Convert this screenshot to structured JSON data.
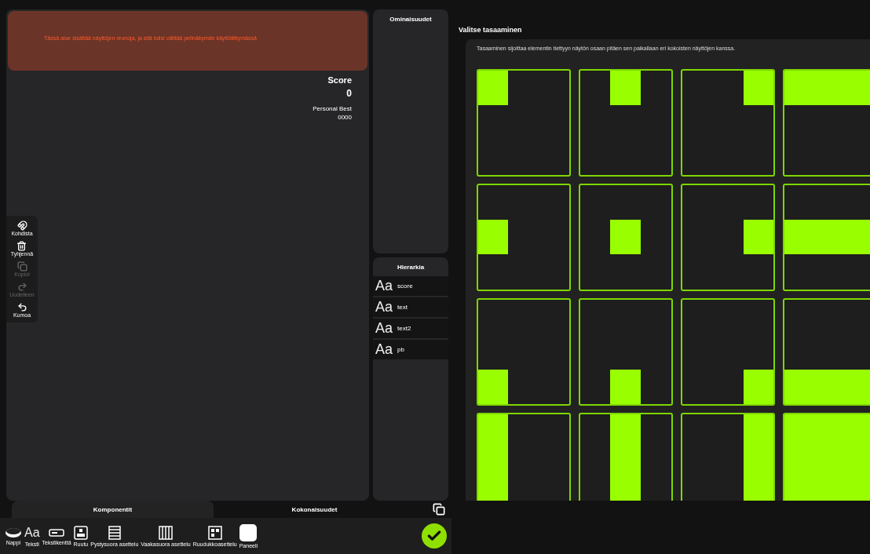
{
  "banner": {
    "text": "Tässä alue sisältää näyttöjen reunoja, ja sitä tulisi välttää pelinäkymän käyttöliittymässä"
  },
  "score": {
    "label": "Score",
    "value": "0",
    "best_label": "Personal Best",
    "best_value": "0000"
  },
  "tools": [
    {
      "label": "Kohdista",
      "disabled": false
    },
    {
      "label": "Tyhjennä",
      "disabled": false
    },
    {
      "label": "Kopioi",
      "disabled": true
    },
    {
      "label": "Uudelleen",
      "disabled": true
    },
    {
      "label": "Kumoa",
      "disabled": false
    }
  ],
  "properties": {
    "title": "Ominaisuudet"
  },
  "hierarchy": {
    "title": "Hierarkia",
    "items": [
      {
        "icon": "Aa",
        "label": "score"
      },
      {
        "icon": "Aa",
        "label": "text"
      },
      {
        "icon": "Aa",
        "label": "text2"
      },
      {
        "icon": "Aa",
        "label": "pb"
      }
    ]
  },
  "bottom_tabs": [
    {
      "label": "Komponentit",
      "selected": true
    },
    {
      "label": "Kokonaisuudet",
      "selected": false
    }
  ],
  "components": [
    {
      "kind": "button",
      "label": "Nappi"
    },
    {
      "kind": "text",
      "label": "Teksti",
      "glyph": "Aa"
    },
    {
      "kind": "field",
      "label": "Tekstikenttä"
    },
    {
      "kind": "box",
      "label": "Ruutu"
    },
    {
      "kind": "rows",
      "label": "Pystysuora asettelu"
    },
    {
      "kind": "columns",
      "label": "Vaakasuora asettelu"
    },
    {
      "kind": "grid",
      "label": "Ruudukkoasettelu"
    },
    {
      "kind": "panel",
      "label": "Paneeli"
    }
  ],
  "anchor": {
    "title": "Valitse tasaaminen",
    "description": "Tasaaminen sijoittaa elementin tiettyyn näytön osaan pitäen sen paikallaan eri kokoisten näyttöjen kanssa.",
    "options": [
      {
        "selected": false
      },
      {
        "selected": false
      },
      {
        "selected": false
      },
      {
        "selected": false
      },
      {
        "selected": false
      },
      {
        "selected": false
      },
      {
        "selected": false
      },
      {
        "selected": false
      },
      {
        "selected": false
      },
      {
        "selected": false
      },
      {
        "selected": false
      },
      {
        "selected": false
      },
      {
        "selected": false
      },
      {
        "selected": false
      },
      {
        "selected": false
      },
      {
        "selected": false
      }
    ]
  }
}
